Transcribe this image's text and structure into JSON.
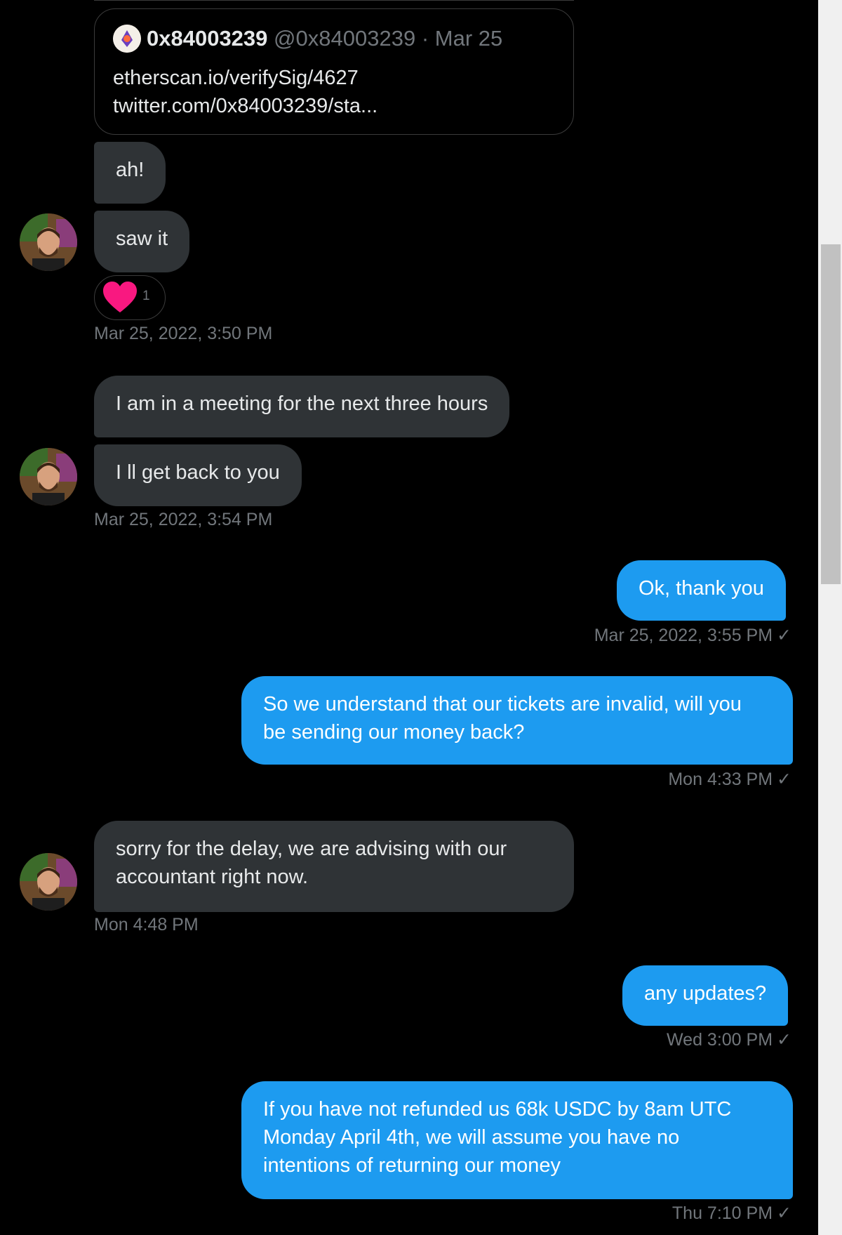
{
  "shared_tweet": {
    "name": "0x84003239",
    "handle": "@0x84003239",
    "date": "Mar 25",
    "lines": [
      "etherscan.io/verifySig/4627",
      "twitter.com/0x84003239/sta..."
    ]
  },
  "messages": [
    {
      "text": "ah!"
    },
    {
      "text": "saw it"
    },
    {
      "reaction_count": "1"
    },
    {
      "timestamp": "Mar 25, 2022, 3:50 PM"
    },
    {
      "text": "I am in a meeting for the next three hours"
    },
    {
      "text": "I ll get back to you"
    },
    {
      "timestamp": "Mar 25, 2022, 3:54 PM"
    },
    {
      "text": "Ok, thank you"
    },
    {
      "timestamp": "Mar 25, 2022, 3:55 PM"
    },
    {
      "text_line1": "So we understand that our tickets are invalid, will you",
      "text_line2": "be sending our money back?"
    },
    {
      "timestamp": "Mon 4:33 PM"
    },
    {
      "text_line1": "sorry for the delay, we are advising with our",
      "text_line2": "accountant right now."
    },
    {
      "timestamp": "Mon 4:48 PM"
    },
    {
      "text": "any updates?"
    },
    {
      "timestamp": "Wed 3:00 PM"
    },
    {
      "text_line1": "If you have not refunded us 68k USDC by 8am UTC",
      "text_line2": "Monday April 4th, we will assume you have no",
      "text_line3": "intentions of returning our money"
    },
    {
      "timestamp": "Thu 7:10 PM"
    }
  ],
  "colors": {
    "background": "#000000",
    "incoming_bubble": "#2f3336",
    "outgoing_bubble": "#1d9bf0",
    "meta_text": "#71767b",
    "reaction_heart": "#f91880"
  },
  "icons": {
    "check": "checkmark-icon",
    "heart": "heart-icon",
    "avatar": "user-avatar"
  }
}
